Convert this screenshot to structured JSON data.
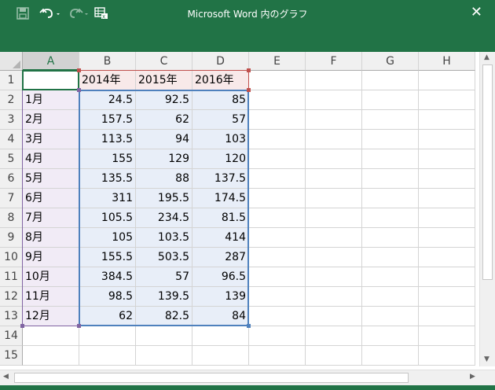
{
  "window": {
    "title": "Microsoft Word 内のグラフ",
    "close_glyph": "✕",
    "accent": "#217346"
  },
  "toolbar": {
    "save_icon": "save-icon",
    "undo_icon": "undo-icon",
    "redo_icon": "redo-icon",
    "edit_data_icon": "edit-data-in-excel-icon"
  },
  "columns": [
    "A",
    "B",
    "C",
    "D",
    "E",
    "F",
    "G",
    "H"
  ],
  "rows": [
    "1",
    "2",
    "3",
    "4",
    "5",
    "6",
    "7",
    "8",
    "9",
    "10",
    "11",
    "12",
    "13",
    "14",
    "15"
  ],
  "grid": [
    [
      "",
      "2014年",
      "2015年",
      "2016年",
      "",
      "",
      "",
      ""
    ],
    [
      "1月",
      "24.5",
      "92.5",
      "85",
      "",
      "",
      "",
      ""
    ],
    [
      "2月",
      "157.5",
      "62",
      "57",
      "",
      "",
      "",
      ""
    ],
    [
      "3月",
      "113.5",
      "94",
      "103",
      "",
      "",
      "",
      ""
    ],
    [
      "4月",
      "155",
      "129",
      "120",
      "",
      "",
      "",
      ""
    ],
    [
      "5月",
      "135.5",
      "88",
      "137.5",
      "",
      "",
      "",
      ""
    ],
    [
      "6月",
      "311",
      "195.5",
      "174.5",
      "",
      "",
      "",
      ""
    ],
    [
      "7月",
      "105.5",
      "234.5",
      "81.5",
      "",
      "",
      "",
      ""
    ],
    [
      "8月",
      "105",
      "103.5",
      "414",
      "",
      "",
      "",
      ""
    ],
    [
      "9月",
      "155.5",
      "503.5",
      "287",
      "",
      "",
      "",
      ""
    ],
    [
      "10月",
      "384.5",
      "57",
      "96.5",
      "",
      "",
      "",
      ""
    ],
    [
      "11月",
      "98.5",
      "139.5",
      "139",
      "",
      "",
      "",
      ""
    ],
    [
      "12月",
      "62",
      "82.5",
      "84",
      "",
      "",
      "",
      ""
    ],
    [
      "",
      "",
      "",
      "",
      "",
      "",
      "",
      ""
    ],
    [
      "",
      "",
      "",
      "",
      "",
      "",
      "",
      ""
    ]
  ],
  "selection": {
    "active_cell": "A1",
    "series_name_range": "B1:D1",
    "category_range": "A2:A13",
    "values_range": "B2:D13"
  },
  "colors": {
    "series_border": "#c0504d",
    "category_border": "#8064a2",
    "values_border": "#4f81bd"
  }
}
